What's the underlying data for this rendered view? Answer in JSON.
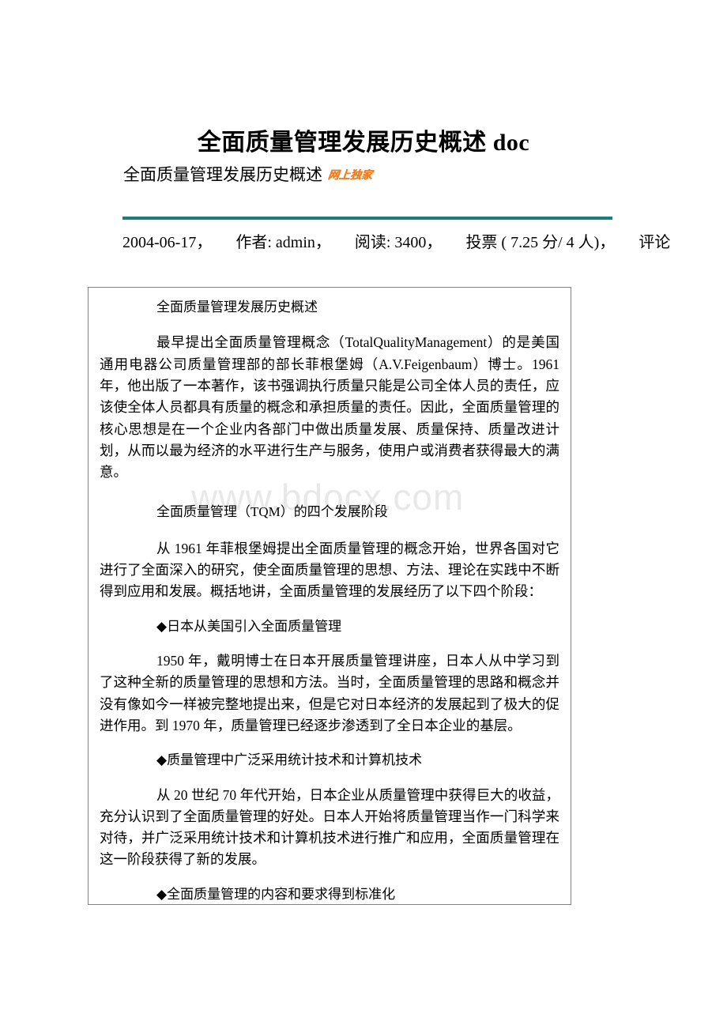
{
  "document": {
    "title": "全面质量管理发展历史概述 doc",
    "subtitle": "全面质量管理发展历史概述",
    "stamp_label": "网上独家",
    "stamp_color": "#f07c1e",
    "rule_color": "#1a7d80",
    "watermark": "www.bdocx.com",
    "meta": {
      "date": "2004-06-17，",
      "author": "作者: admin，",
      "reads": "阅读: 3400，",
      "vote": "投票 ( 7.25 分/ 4 人)，",
      "comment": "评论"
    },
    "content": {
      "heading": "全面质量管理发展历史概述",
      "paragraph_1": "最早提出全面质量管理概念（TotalQualityManagement）的是美国通用电器公司质量管理部的部长菲根堡姆（A.V.Feigenbaum）博士。1961 年，他出版了一本著作，该书强调执行质量只能是公司全体人员的责任，应该使全体人员都具有质量的概念和承担质量的责任。因此，全面质量管理的核心思想是在一个企业内各部门中做出质量发展、质量保持、质量改进计划，从而以最为经济的水平进行生产与服务，使用户或消费者获得最大的满意。",
      "section_title": "全面质量管理（TQM）的四个发展阶段",
      "paragraph_2": "从 1961 年菲根堡姆提出全面质量管理的概念开始，世界各国对它进行了全面深入的研究，使全面质量管理的思想、方法、理论在实践中不断得到应用和发展。概括地讲，全面质量管理的发展经历了以下四个阶段：",
      "bullet_1": "◆日本从美国引入全面质量管理",
      "paragraph_3": "1950 年，戴明博士在日本开展质量管理讲座，日本人从中学习到了这种全新的质量管理的思想和方法。当时，全面质量管理的思路和概念并没有像如今一样被完整地提出来，但是它对日本经济的发展起到了极大的促进作用。到 1970 年，质量管理已经逐步渗透到了全日本企业的基层。",
      "bullet_2": "◆质量管理中广泛采用统计技术和计算机技术",
      "paragraph_4": "从 20 世纪 70 年代开始，日本企业从质量管理中获得巨大的收益，充分认识到了全面质量管理的好处。日本人开始将质量管理当作一门科学来对待，并广泛采用统计技术和计算机技术进行推广和应用，全面质量管理在这一阶段获得了新的发展。",
      "bullet_3": "◆全面质量管理的内容和要求得到标准化"
    }
  }
}
